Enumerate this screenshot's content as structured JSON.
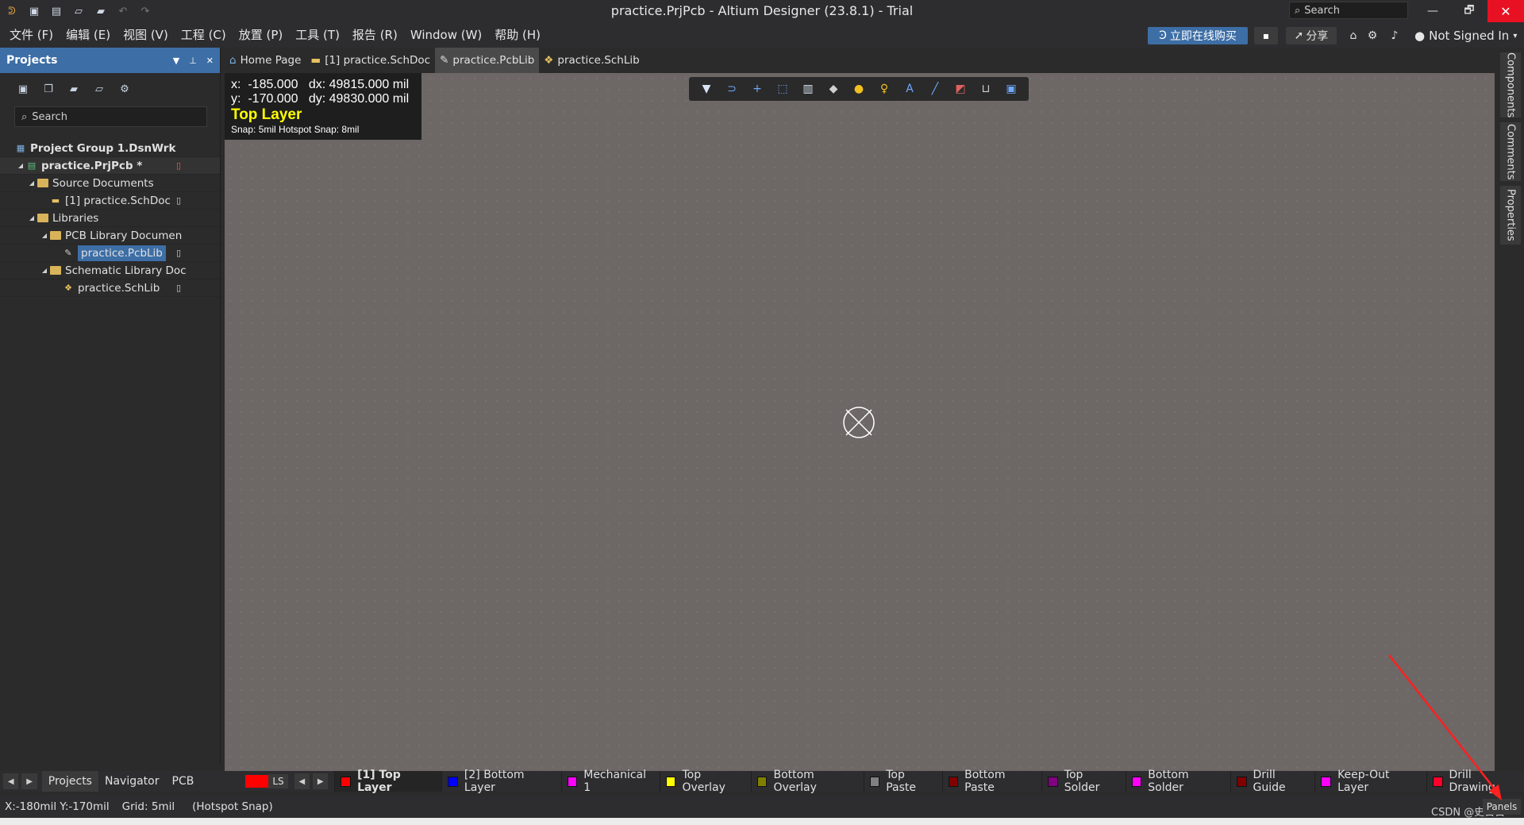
{
  "window": {
    "title": "practice.PrjPcb - Altium Designer (23.8.1) - Trial",
    "search_label": "Search",
    "close_glyph": "✕",
    "max_glyph": "🗗",
    "min_glyph": "—"
  },
  "menu": {
    "items": [
      "文件 (F)",
      "编辑 (E)",
      "视图 (V)",
      "工程 (C)",
      "放置 (P)",
      "工具 (T)",
      "报告 (R)",
      "Window (W)",
      "帮助 (H)"
    ],
    "buy_label": "立即在线购买",
    "share_label": "分享",
    "user_label": "Not Signed In"
  },
  "projects_panel": {
    "title": "Projects",
    "search_placeholder": "Search",
    "tree": [
      {
        "label": "Project Group 1.DsnWrk"
      },
      {
        "label": "practice.PrjPcb *"
      },
      {
        "label": "Source Documents"
      },
      {
        "label": "[1] practice.SchDoc"
      },
      {
        "label": "Libraries"
      },
      {
        "label": "PCB Library Documen"
      },
      {
        "label": "practice.PcbLib"
      },
      {
        "label": "Schematic Library Doc"
      },
      {
        "label": "practice.SchLib"
      }
    ]
  },
  "doc_tabs": [
    "Home Page",
    "[1] practice.SchDoc",
    "practice.PcbLib",
    "practice.SchLib"
  ],
  "canvas": {
    "x_line": "x:  -185.000   dx: 49815.000 mil",
    "y_line": "y:  -170.000   dy: 49830.000 mil",
    "layer": "Top Layer",
    "snap": "Snap: 5mil Hotspot Snap: 8mil"
  },
  "right_dock": [
    "Components",
    "Comments",
    "Properties"
  ],
  "bottom_tabs": [
    "Projects",
    "Navigator",
    "PCB Library"
  ],
  "ls_label": "LS",
  "layers": [
    {
      "label": "[1] Top Layer",
      "color": "#ff0000"
    },
    {
      "label": "[2] Bottom Layer",
      "color": "#0000ff"
    },
    {
      "label": "Mechanical 1",
      "color": "#ff00ff"
    },
    {
      "label": "Top Overlay",
      "color": "#ffff00"
    },
    {
      "label": "Bottom Overlay",
      "color": "#808000"
    },
    {
      "label": "Top Paste",
      "color": "#808080"
    },
    {
      "label": "Bottom Paste",
      "color": "#800000"
    },
    {
      "label": "Top Solder",
      "color": "#800080"
    },
    {
      "label": "Bottom Solder",
      "color": "#ff00ff"
    },
    {
      "label": "Drill Guide",
      "color": "#800000"
    },
    {
      "label": "Keep-Out Layer",
      "color": "#ff00ff"
    },
    {
      "label": "Drill Drawing",
      "color": "#ff002a"
    }
  ],
  "status": {
    "coords": "X:-180mil Y:-170mil",
    "grid": "Grid: 5mil",
    "snap": "(Hotspot Snap)",
    "panels": "Panels",
    "watermark": "CSDN @史目目"
  },
  "colors": {
    "accent": "#3d6ea6",
    "canvas": "#6d6766",
    "layer_text": "#ffff00"
  }
}
